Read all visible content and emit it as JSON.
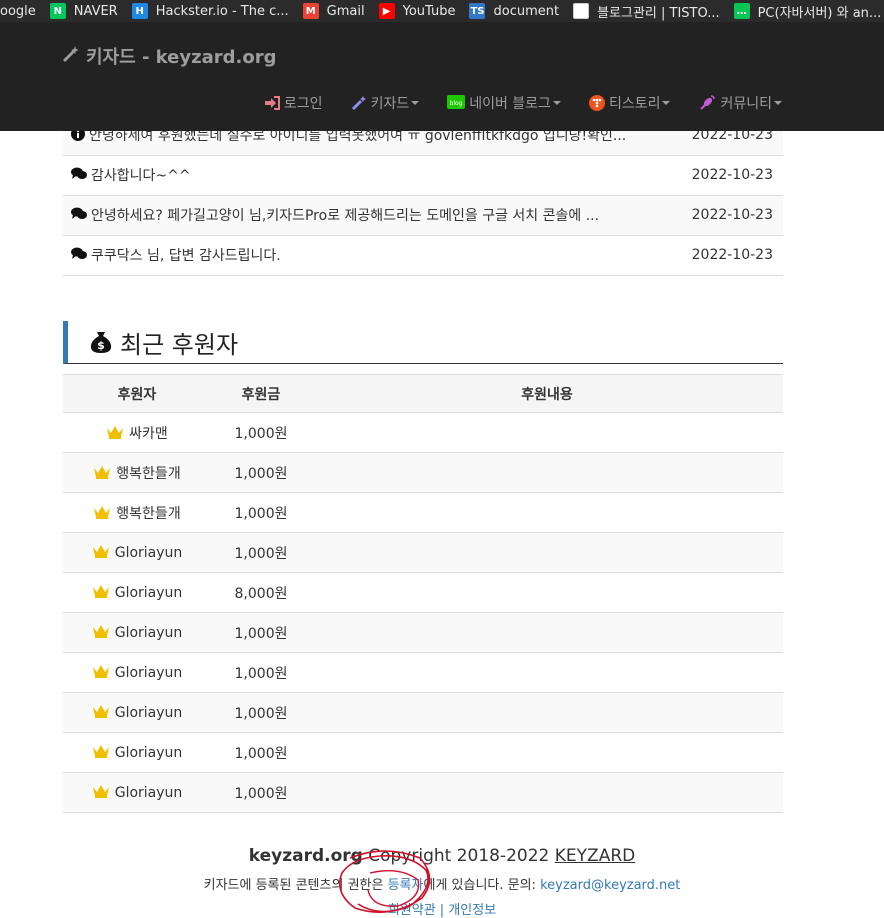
{
  "bookmarks": [
    {
      "label": "oogle",
      "icon": "google-icon",
      "color": "#2b2b2b"
    },
    {
      "label": "NAVER",
      "icon": "naver-icon",
      "color": "#03c75a"
    },
    {
      "label": "Hackster.io - The c...",
      "icon": "hackster-icon",
      "color": "#1e88e5"
    },
    {
      "label": "Gmail",
      "icon": "gmail-icon",
      "color": "#ea4335"
    },
    {
      "label": "YouTube",
      "icon": "youtube-icon",
      "color": "#ff0000"
    },
    {
      "label": "document",
      "icon": "ts-icon",
      "color": "#3178c6"
    },
    {
      "label": "블로그관리 | TISTO...",
      "icon": "blank-page-icon",
      "color": "#ffffff"
    },
    {
      "label": "PC(자바서버) 와 an...",
      "icon": "chat-icon",
      "color": "#06c755"
    }
  ],
  "site": {
    "brand": "키자드 - keyzard.org",
    "nav": {
      "login": "로그인",
      "keyzard": "키자드",
      "naver_blog": "네이버 블로그",
      "tistory": "티스토리",
      "community": "커뮤니티"
    }
  },
  "posts": [
    {
      "title": "안녕하세여 후원했는데 실수로 아이디를 입력못했어여 ㅠ govlenffltkfkdgo 입니당!확인...",
      "date": "2022-10-23",
      "icon": "info-icon"
    },
    {
      "title": "감사합니다~^^",
      "date": "2022-10-23",
      "icon": "comments-icon"
    },
    {
      "title": "안녕하세요? 페가길고양이 님,키자드Pro로 제공해드리는 도메인을 구글 서치 콘솔에 ...",
      "date": "2022-10-23",
      "icon": "comments-icon"
    },
    {
      "title": "쿠쿠닥스 님, 답변 감사드립니다.",
      "date": "2022-10-23",
      "icon": "comments-icon"
    }
  ],
  "donors_section": {
    "title": "최근 후원자",
    "headers": {
      "name": "후원자",
      "amount": "후원금",
      "content": "후원내용"
    },
    "rows": [
      {
        "name": "싸카맨",
        "amount": "1,000원",
        "content": ""
      },
      {
        "name": "행복한들개",
        "amount": "1,000원",
        "content": ""
      },
      {
        "name": "행복한들개",
        "amount": "1,000원",
        "content": ""
      },
      {
        "name": "Gloriayun",
        "amount": "1,000원",
        "content": ""
      },
      {
        "name": "Gloriayun",
        "amount": "8,000원",
        "content": ""
      },
      {
        "name": "Gloriayun",
        "amount": "1,000원",
        "content": ""
      },
      {
        "name": "Gloriayun",
        "amount": "1,000원",
        "content": ""
      },
      {
        "name": "Gloriayun",
        "amount": "1,000원",
        "content": ""
      },
      {
        "name": "Gloriayun",
        "amount": "1,000원",
        "content": ""
      },
      {
        "name": "Gloriayun",
        "amount": "1,000원",
        "content": ""
      }
    ]
  },
  "footer": {
    "site": "keyzard.org",
    "copyright": "Copyright 2018-2022",
    "owner": "KEYZARD",
    "rights_prefix": "키자드에 등록된 콘텐츠의 권한은",
    "rights_link": "등록자",
    "rights_suffix": "에게 있습니다. 문의:",
    "email": "keyzard@keyzard.net",
    "bottom_links": "회원약관 | 개인정보"
  },
  "colors": {
    "navbar": "#222222",
    "accent": "#337ab7",
    "crown": "#f0c000",
    "annotation": "#d0102a"
  }
}
